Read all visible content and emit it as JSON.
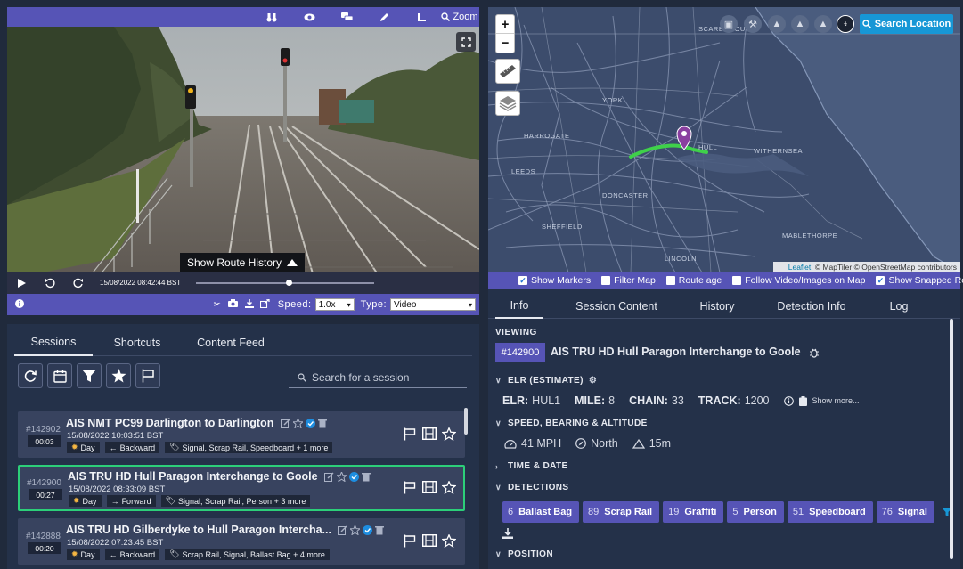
{
  "video": {
    "toolbar": {
      "zoom_label": "Zoom"
    },
    "route_history_label": "Show Route History",
    "timestamp": "15/08/2022 08:42:44 BST",
    "progress": 0.52,
    "speed_label": "Speed:",
    "speed_value": "1.0x",
    "type_label": "Type:",
    "type_value": "Video"
  },
  "sessions": {
    "tabs": [
      "Sessions",
      "Shortcuts",
      "Content Feed"
    ],
    "search_placeholder": "Search for a session",
    "items": [
      {
        "id": "#142902",
        "duration": "00:03",
        "title": "AIS NMT PC99 Darlington to Darlington",
        "date": "15/08/2022 10:03:51 BST",
        "light": "Day",
        "direction": "Backward",
        "tags": "Signal, Scrap Rail, Speedboard + 1 more",
        "selected": false
      },
      {
        "id": "#142900",
        "duration": "00:27",
        "title": "AIS TRU HD Hull Paragon Interchange to Goole",
        "date": "15/08/2022 08:33:09 BST",
        "light": "Day",
        "direction": "Forward",
        "tags": "Signal, Scrap Rail, Person + 3 more",
        "selected": true
      },
      {
        "id": "#142888",
        "duration": "00:20",
        "title": "AIS TRU HD Gilberdyke to Hull Paragon Intercha...",
        "date": "15/08/2022 07:23:45 BST",
        "light": "Day",
        "direction": "Backward",
        "tags": "Scrap Rail, Signal, Ballast Bag + 4 more",
        "selected": false
      }
    ]
  },
  "map": {
    "search_label": "Search Location",
    "places": [
      "SCARBOROUGH",
      "YORK",
      "DONCASTER",
      "SHEFFIELD",
      "LINCOLN",
      "HULL",
      "WITHERNSEA",
      "MABLETHORPE",
      "HARROGATE",
      "LEEDS"
    ],
    "attribution": {
      "leaflet": "Leaflet",
      "rest": " | © MapTiler © OpenStreetMap contributors"
    },
    "options": [
      {
        "label": "Show Markers",
        "checked": true
      },
      {
        "label": "Filter Map",
        "checked": false
      },
      {
        "label": "Route age",
        "checked": false
      },
      {
        "label": "Follow Video/Images on Map",
        "checked": false
      },
      {
        "label": "Show Snapped Route",
        "checked": true
      }
    ]
  },
  "info": {
    "tabs": [
      "Info",
      "Session Content",
      "History",
      "Detection Info",
      "Log"
    ],
    "viewing_label": "VIEWING",
    "viewing_id": "#142900",
    "viewing_title": "AIS TRU HD Hull Paragon Interchange to Goole",
    "elr_section": "ELR (ESTIMATE)",
    "elr": {
      "elr_k": "ELR:",
      "elr_v": "HUL1",
      "mile_k": "MILE:",
      "mile_v": "8",
      "chain_k": "CHAIN:",
      "chain_v": "33",
      "track_k": "TRACK:",
      "track_v": "1200",
      "show_more": "Show more..."
    },
    "speed_section": "SPEED, BEARING & ALTITUDE",
    "speed": "41 MPH",
    "bearing": "North",
    "altitude": "15m",
    "time_section": "TIME & DATE",
    "detections_section": "DETECTIONS",
    "detections": [
      {
        "count": "6",
        "label": "Ballast Bag"
      },
      {
        "count": "89",
        "label": "Scrap Rail"
      },
      {
        "count": "19",
        "label": "Graffiti"
      },
      {
        "count": "5",
        "label": "Person"
      },
      {
        "count": "51",
        "label": "Speedboard"
      },
      {
        "count": "76",
        "label": "Signal"
      }
    ],
    "position_section": "POSITION"
  },
  "colors": {
    "accent": "#5654b6",
    "panel": "#243149",
    "selected_border": "#2ccf79",
    "search_button": "#1797d6",
    "route": "#3fd14a",
    "marker": "#8a3fa0"
  }
}
